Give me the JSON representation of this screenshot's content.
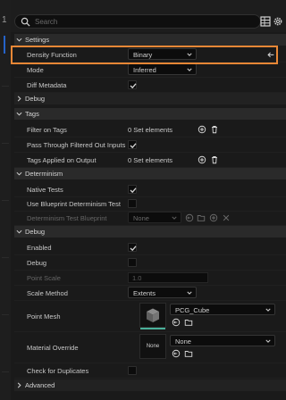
{
  "left": {
    "number": "1"
  },
  "search": {
    "placeholder": "Search"
  },
  "sections": {
    "settings": "Settings",
    "debug_collapsed": "Debug",
    "tags": "Tags",
    "determinism": "Determinism",
    "debug": "Debug",
    "advanced": "Advanced"
  },
  "settings": {
    "density_function_label": "Density Function",
    "density_function_value": "Binary",
    "mode_label": "Mode",
    "mode_value": "Inferred",
    "diff_metadata_label": "Diff Metadata",
    "diff_metadata_checked": true
  },
  "tags": {
    "filter_on_tags_label": "Filter on Tags",
    "filter_on_tags_value": "0 Set elements",
    "pass_through_label": "Pass Through Filtered Out Inputs",
    "pass_through_checked": true,
    "tags_applied_label": "Tags Applied on Output",
    "tags_applied_value": "0 Set elements"
  },
  "determinism": {
    "native_tests_label": "Native Tests",
    "native_tests_checked": true,
    "use_blueprint_label": "Use Blueprint Determinism Test",
    "use_blueprint_checked": false,
    "blueprint_label": "Determinism Test Blueprint",
    "blueprint_value": "None"
  },
  "debug": {
    "enabled_label": "Enabled",
    "enabled_checked": true,
    "debug_label": "Debug",
    "debug_checked": false,
    "point_scale_label": "Point Scale",
    "point_scale_value": "1.0",
    "scale_method_label": "Scale Method",
    "scale_method_value": "Extents",
    "point_mesh_label": "Point Mesh",
    "point_mesh_value": "PCG_Cube",
    "material_override_label": "Material Override",
    "material_override_value": "None",
    "material_thumb_label": "None",
    "check_duplicates_label": "Check for Duplicates",
    "check_duplicates_checked": false
  },
  "colors": {
    "highlight": "#e98736",
    "accent_blue": "#2563c9",
    "checkbox_check": "#d8d8d8"
  }
}
